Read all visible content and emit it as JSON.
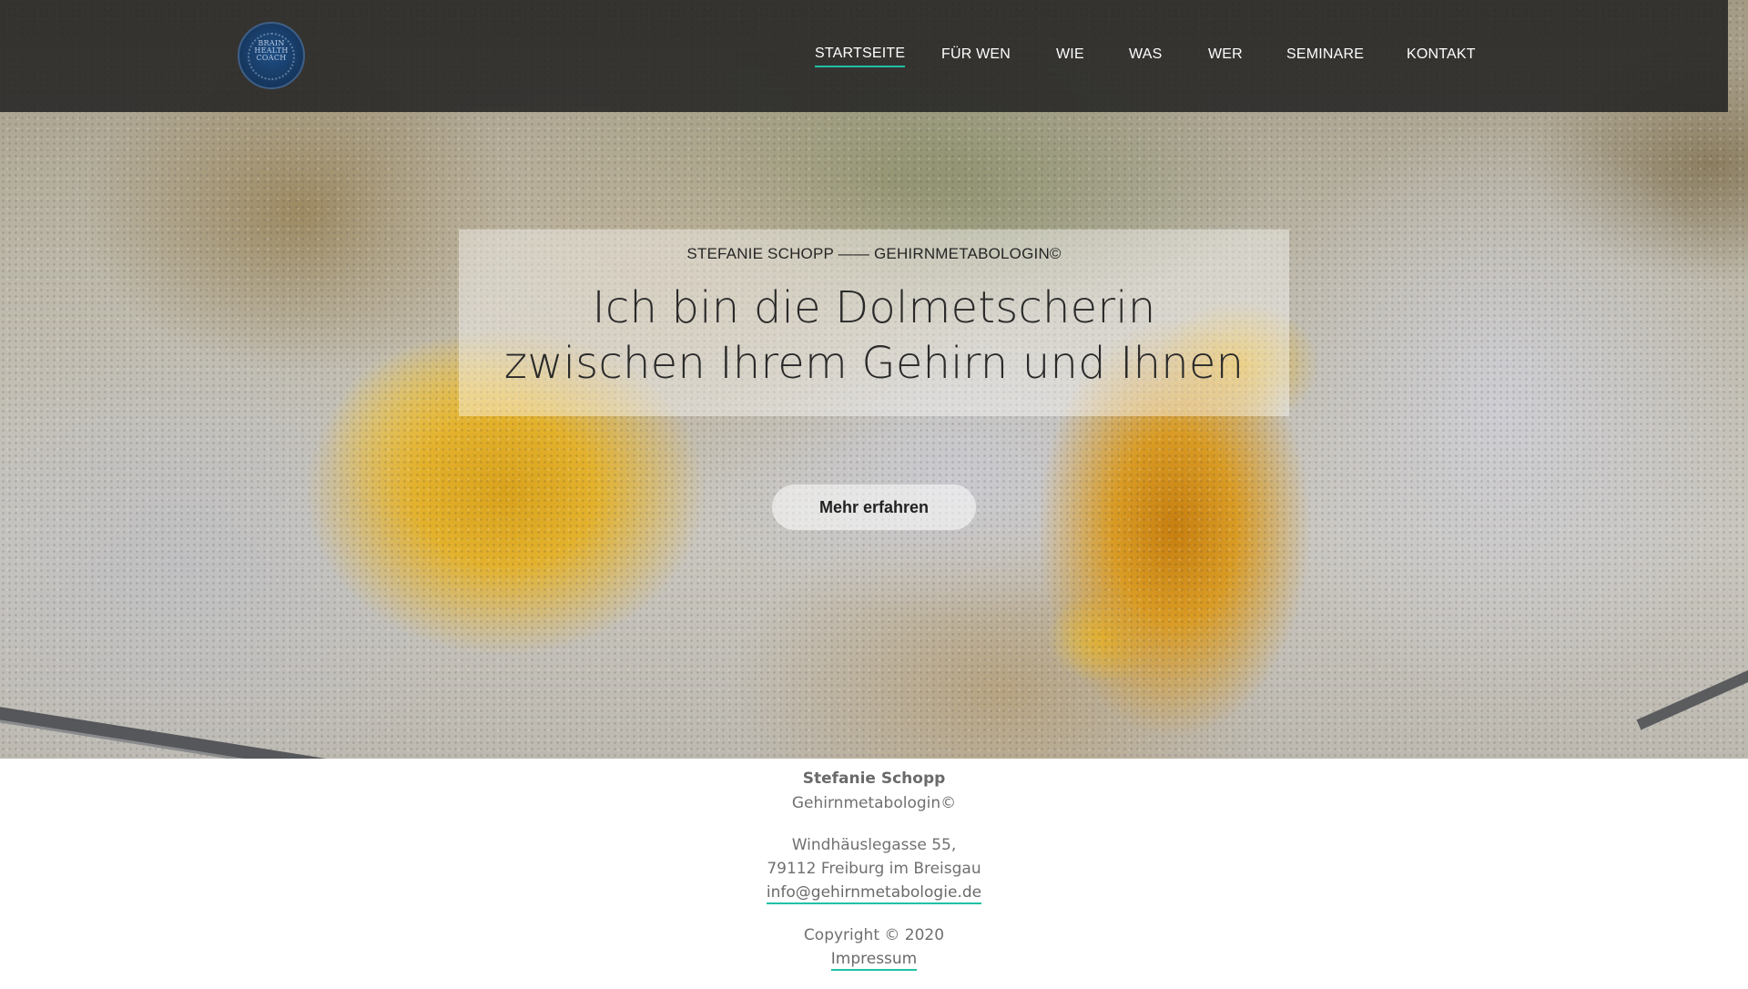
{
  "brand": {
    "logo_lines": [
      "BRAIN",
      "HEALTH",
      "COACH"
    ]
  },
  "nav": {
    "items": [
      {
        "label": "STARTSEITE",
        "active": true
      },
      {
        "label": "FÜR WEN"
      },
      {
        "label": "WIE"
      },
      {
        "label": "WAS"
      },
      {
        "label": "WER"
      },
      {
        "label": "SEMINARE"
      },
      {
        "label": "KONTAKT"
      }
    ]
  },
  "hero": {
    "eyebrow": "STEFANIE SCHOPP —— GEHIRNMETABOLOGIN©",
    "headline_line1": "Ich bin die Dolmetscherin",
    "headline_line2": "zwischen Ihrem Gehirn und Ihnen",
    "cta_label": "Mehr erfahren"
  },
  "footer": {
    "name": "Stefanie Schopp",
    "title": "Gehirnmetabologin©",
    "street": "Windhäuslegasse 55,",
    "city": "79112 Freiburg im Breisgau",
    "email": "info@gehirnmetabologie.de",
    "copyright": "Copyright © 2020",
    "impressum": "Impressum"
  },
  "colors": {
    "accent": "#1fc2a6",
    "navbar_bg": "#222222",
    "text_dark": "#2a2a2a",
    "footer_text": "#707070"
  }
}
